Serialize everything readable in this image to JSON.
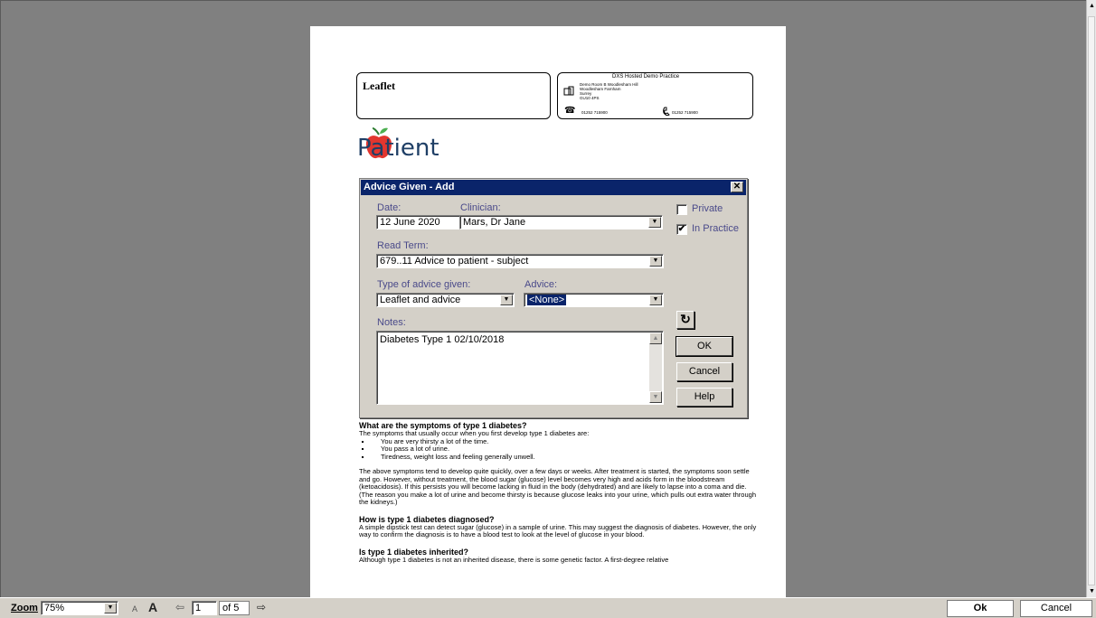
{
  "document": {
    "leaflet_title": "Leaflet",
    "practice": {
      "name": "DXS Hosted Demo Practice",
      "address_lines": [
        "Demo Room B Woodlesham Hill",
        "Woodlesham Farnham",
        "Surrey",
        "GU10 4PS"
      ],
      "phone": "01252 715900",
      "fax": "01252 715900"
    },
    "logo_text": "Patient",
    "sections": [
      {
        "heading": "What are the symptoms of type 1 diabetes?",
        "intro": "The symptoms that usually occur when you first develop type 1 diabetes are:",
        "bullets": [
          "You are very thirsty a lot of the time.",
          "You pass a lot of urine.",
          "Tiredness, weight loss and feeling generally unwell."
        ],
        "paragraph": "The above symptoms tend to develop quite quickly, over a few days or weeks. After treatment is started, the symptoms soon settle and go. However, without treatment, the blood sugar (glucose) level becomes very high and acids form in the bloodstream (ketoacidosis). If this persists you will become lacking in fluid in the body (dehydrated) and are likely to lapse into a coma and die. (The reason you make a lot of urine and become thirsty is because glucose leaks into your urine, which pulls out extra water through the kidneys.)"
      },
      {
        "heading": "How is type 1 diabetes diagnosed?",
        "paragraph": "A simple dipstick test can detect sugar (glucose) in a sample of urine. This may suggest the diagnosis of diabetes. However, the only way to confirm the diagnosis is to have a blood test to look at the level of glucose in your blood."
      },
      {
        "heading": "Is type 1 diabetes inherited?",
        "paragraph": "Although type 1 diabetes is not an inherited disease, there is some genetic factor. A first-degree relative"
      }
    ]
  },
  "dialog": {
    "title": "Advice Given - Add",
    "close_glyph": "✕",
    "date_label": "Date:",
    "date_value": "12 June 2020",
    "clinician_label": "Clinician:",
    "clinician_value": "Mars, Dr Jane",
    "private_label": "Private",
    "in_practice_label": "In Practice",
    "read_term_label": "Read Term:",
    "read_term_value": "679..11 Advice to patient - subject",
    "type_label": "Type of advice given:",
    "type_value": "Leaflet and advice",
    "advice_label": "Advice:",
    "advice_value": "<None>",
    "notes_label": "Notes:",
    "notes_value": "Diabetes Type 1 02/10/2018",
    "ok_label": "OK",
    "cancel_label": "Cancel",
    "help_label": "Help"
  },
  "toolbar": {
    "zoom_label": "Zoom",
    "zoom_value": "75%",
    "page_value": "1",
    "page_of": "of 5",
    "ok_label": "Ok",
    "cancel_label": "Cancel"
  },
  "icons": {
    "dropdown": "▼",
    "checkmark": "✔",
    "phone": "☎",
    "refresh": "↻",
    "prev": "⇦",
    "next": "⇨",
    "font_small": "A",
    "font_large": "A"
  },
  "colors": {
    "titlebar": "#0a246a",
    "dialog_bg": "#d4d0c8",
    "viewer_bg": "#808080",
    "logo_text": "#1f3f66",
    "logo_apple": "#e2362f"
  }
}
